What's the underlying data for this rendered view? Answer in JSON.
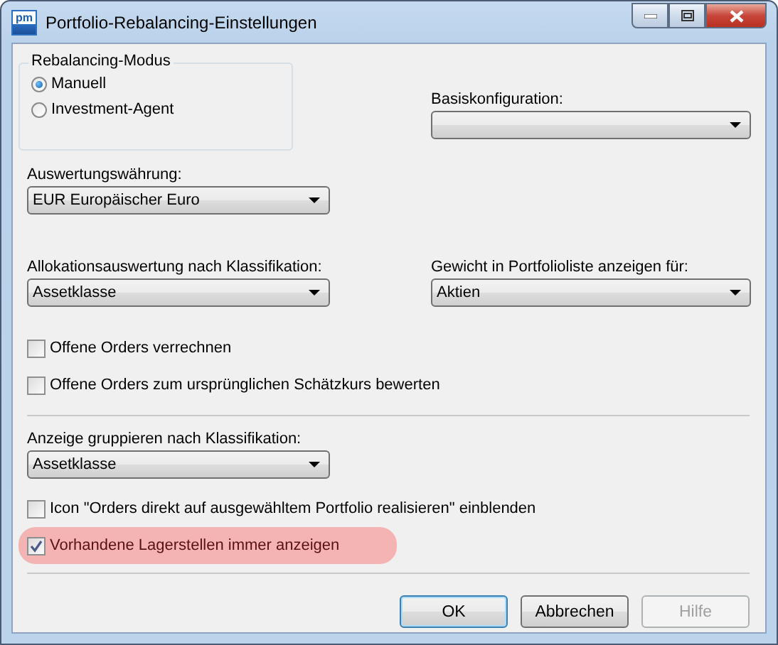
{
  "window": {
    "title": "Portfolio-Rebalancing-Einstellungen",
    "app_icon_text": "pm"
  },
  "rebalancing_mode": {
    "title": "Rebalancing-Modus",
    "options": [
      {
        "label": "Manuell",
        "selected": true
      },
      {
        "label": "Investment-Agent",
        "selected": false
      }
    ]
  },
  "base_configuration": {
    "label": "Basiskonfiguration:"
  },
  "currency": {
    "label": "Auswertungswährung:",
    "value": "EUR Europäischer Euro"
  },
  "allocation": {
    "label": "Allokationsauswertung nach Klassifikation:",
    "value": "Assetklasse"
  },
  "weight": {
    "label": "Gewicht in Portfolioliste anzeigen für:",
    "value": "Aktien"
  },
  "order_options": [
    {
      "label": "Offene Orders verrechnen",
      "checked": false,
      "highlighted": false
    },
    {
      "label": "Offene Orders zum ursprünglichen Schätzkurs bewerten",
      "checked": false,
      "highlighted": false
    }
  ],
  "grouping": {
    "label": "Anzeige gruppieren nach Klassifikation:",
    "value": "Assetklasse"
  },
  "display_options": [
    {
      "label": "Icon \"Orders direkt auf ausgewähltem Portfolio realisieren\" einblenden",
      "checked": false,
      "highlighted": false
    },
    {
      "label": "Vorhandene Lagerstellen immer anzeigen",
      "checked": true,
      "highlighted": true
    }
  ],
  "buttons": [
    {
      "label": "OK",
      "default": true,
      "disabled": false
    },
    {
      "label": "Abbrechen",
      "default": false,
      "disabled": false
    },
    {
      "label": "Hilfe",
      "default": false,
      "disabled": true
    }
  ]
}
